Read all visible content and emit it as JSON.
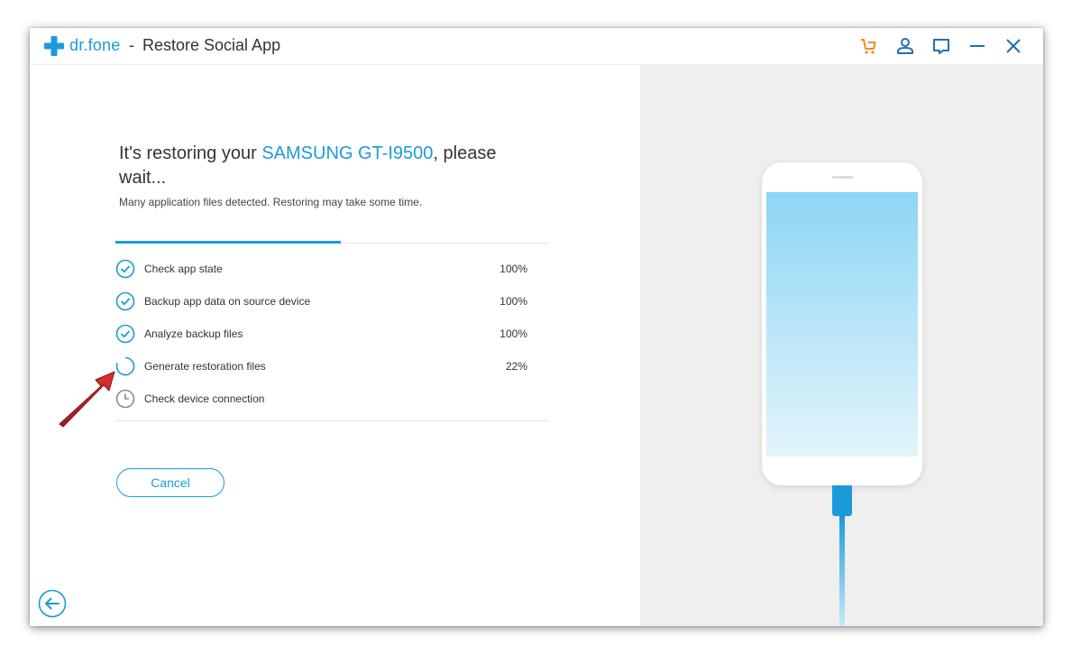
{
  "window": {
    "brand": "dr.fone",
    "separator": "-",
    "title": "Restore Social App"
  },
  "toolbar": {
    "icons": [
      "cart-icon",
      "user-icon",
      "feedback-icon",
      "minimize-icon",
      "close-icon"
    ]
  },
  "main": {
    "heading_prefix": "It's restoring your ",
    "device_name": "SAMSUNG GT-I9500",
    "heading_suffix": ", please wait...",
    "subtext": "Many application files detected. Restoring may take some time.",
    "overall_progress": 0.52,
    "steps": [
      {
        "label": "Check app state",
        "percent": "100%",
        "status": "done"
      },
      {
        "label": "Backup app data on source device",
        "percent": "100%",
        "status": "done"
      },
      {
        "label": "Analyze backup files",
        "percent": "100%",
        "status": "done"
      },
      {
        "label": "Generate restoration files",
        "percent": "22%",
        "status": "in-progress"
      },
      {
        "label": "Check device connection",
        "percent": "",
        "status": "pending"
      }
    ],
    "cancel_label": "Cancel"
  },
  "colors": {
    "accent": "#1a9bd8",
    "cart": "#f08a24",
    "annotation_arrow": "#c8161d"
  }
}
